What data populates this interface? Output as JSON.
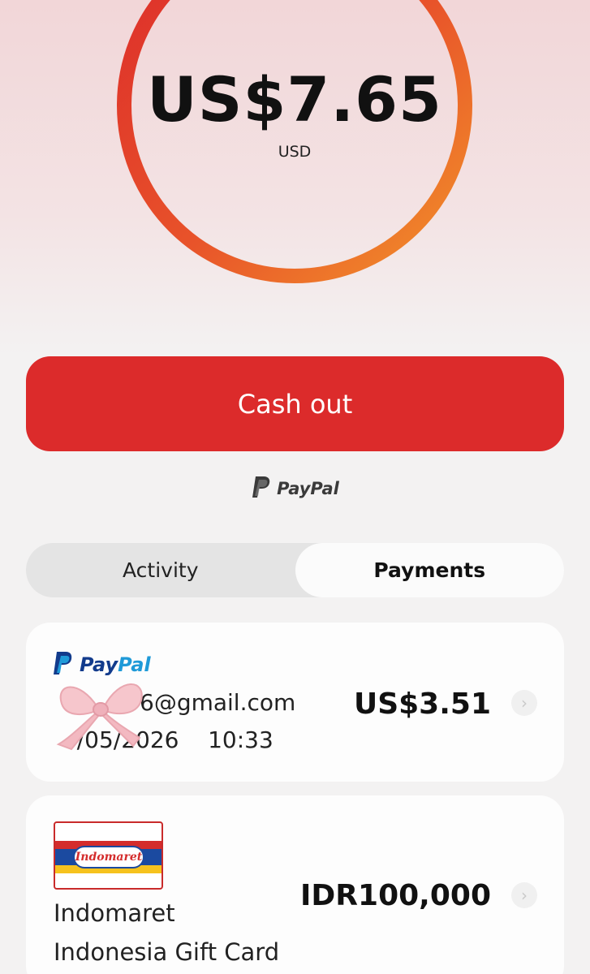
{
  "balance": {
    "amount": "US$7.65",
    "currency": "USD"
  },
  "cashout": {
    "label": "Cash out"
  },
  "payout_method": {
    "name": "PayPal"
  },
  "tabs": [
    {
      "label": "Activity",
      "active": false
    },
    {
      "label": "Payments",
      "active": true
    }
  ],
  "payments": [
    {
      "provider": "PayPal",
      "provider_parts": [
        "Pay",
        "Pal"
      ],
      "email": "6@gmail.com",
      "date": "/05/2026",
      "time": "10:33",
      "amount": "US$3.51"
    },
    {
      "provider": "Indomaret",
      "logo_text": "Indomaret",
      "line1": "Indomaret",
      "line2": "Indonesia Gift Card",
      "amount": "IDR100,000"
    }
  ],
  "colors": {
    "accent_red": "#dc2b2b",
    "ring_start": "#dc2b2b",
    "ring_end": "#f2922a",
    "paypal_dark_blue": "#123b8c",
    "paypal_light_blue": "#1f9ad8"
  }
}
